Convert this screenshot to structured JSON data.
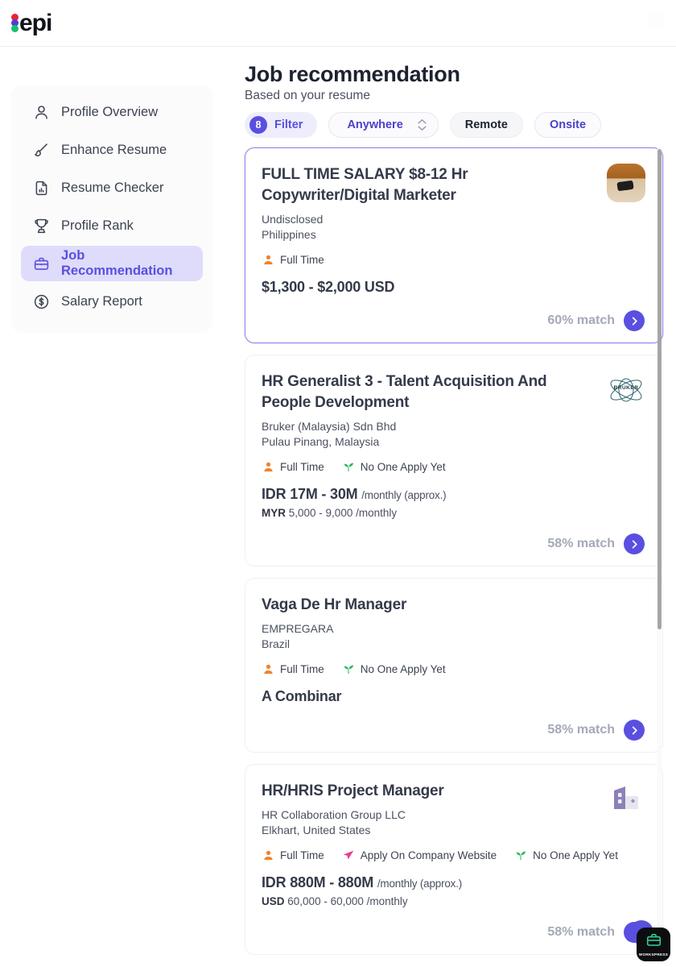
{
  "brand": {
    "name": "epi",
    "dot_colors": [
      "#e8213c",
      "#4b3fd4",
      "#17c06a"
    ]
  },
  "accent": "#5a4fe0",
  "sidebar": {
    "items": [
      {
        "label": "Profile Overview",
        "icon": "user-icon",
        "active": false
      },
      {
        "label": "Enhance Resume",
        "icon": "paintbrush-icon",
        "active": false
      },
      {
        "label": "Resume Checker",
        "icon": "document-chart-icon",
        "active": false
      },
      {
        "label": "Profile Rank",
        "icon": "trophy-icon",
        "active": false
      },
      {
        "label": "Job Recommendation",
        "icon": "briefcase-icon",
        "active": true
      },
      {
        "label": "Salary Report",
        "icon": "dollar-circle-icon",
        "active": false
      }
    ]
  },
  "header": {
    "title": "Job recommendation",
    "subtitle": "Based on your resume"
  },
  "filters": {
    "filter_label": "Filter",
    "filter_count": "8",
    "location_label": "Anywhere",
    "remote_label": "Remote",
    "onsite_label": "Onsite"
  },
  "jobs": [
    {
      "title": "FULL TIME SALARY $8-12 Hr Copywriter/Digital Marketer",
      "company": "Undisclosed",
      "location": "Philippines",
      "tags": [
        {
          "label": "Full Time",
          "icon": "person-filled-icon",
          "color": "#f0832d"
        }
      ],
      "salary_main": "$1,300 - $2,000 USD",
      "salary_unit": "",
      "salary_sub_currency": "",
      "salary_sub_value": "",
      "match": "60% match",
      "logo": "photo-avatar",
      "selected": true
    },
    {
      "title": "HR Generalist 3 - Talent Acquisition And People Development",
      "company": "Bruker (Malaysia) Sdn Bhd",
      "location": "Pulau Pinang, Malaysia",
      "tags": [
        {
          "label": "Full Time",
          "icon": "person-filled-icon",
          "color": "#f0832d"
        },
        {
          "label": "No One Apply Yet",
          "icon": "seedling-icon",
          "color": "#2eb85c"
        }
      ],
      "salary_main": "IDR 17M - 30M",
      "salary_unit": "/monthly (approx.)",
      "salary_sub_currency": "MYR",
      "salary_sub_value": "5,000 - 9,000 /monthly",
      "match": "58% match",
      "logo": "bruker-logo",
      "logo_text": "BRUKER",
      "selected": false
    },
    {
      "title": "Vaga De Hr Manager",
      "company": "EMPREGARA",
      "location": "Brazil",
      "tags": [
        {
          "label": "Full Time",
          "icon": "person-filled-icon",
          "color": "#f0832d"
        },
        {
          "label": "No One Apply Yet",
          "icon": "seedling-icon",
          "color": "#2eb85c"
        }
      ],
      "salary_main": "A Combinar",
      "salary_unit": "",
      "salary_sub_currency": "",
      "salary_sub_value": "",
      "match": "58% match",
      "logo": "none",
      "selected": false
    },
    {
      "title": "HR/HRIS Project Manager",
      "company": "HR Collaboration Group LLC",
      "location": "Elkhart, United States",
      "tags": [
        {
          "label": "Full Time",
          "icon": "person-filled-icon",
          "color": "#f0832d"
        },
        {
          "label": "Apply On Company Website",
          "icon": "paper-plane-icon",
          "color": "#ec3c8e"
        },
        {
          "label": "No One Apply Yet",
          "icon": "seedling-icon",
          "color": "#2eb85c"
        }
      ],
      "salary_main": "IDR 880M - 880M",
      "salary_unit": "/monthly (approx.)",
      "salary_sub_currency": "USD",
      "salary_sub_value": "60,000 - 60,000 /monthly",
      "match": "58% match",
      "logo": "building-icon",
      "selected": false
    }
  ],
  "widget": {
    "label": "WORKSPRESS",
    "icon": "briefcase-icon"
  }
}
